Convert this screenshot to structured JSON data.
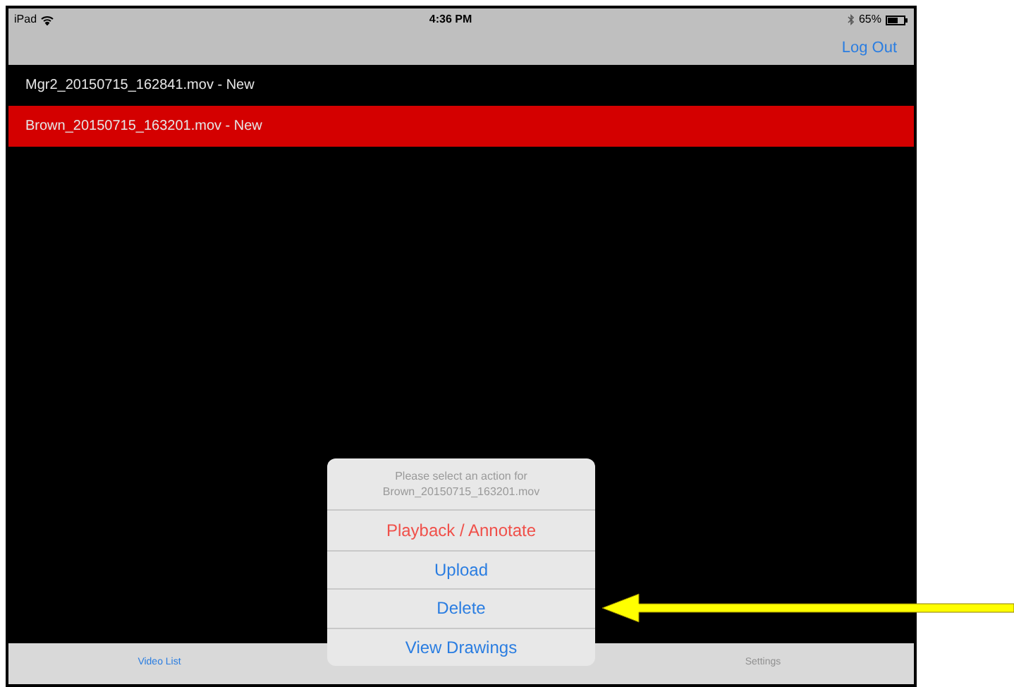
{
  "status_bar": {
    "device": "iPad",
    "time": "4:36 PM",
    "battery": "65%"
  },
  "nav_bar": {
    "button": "Log Out"
  },
  "videos": [
    {
      "name": "Mgr2_20150715_162841.mov - New",
      "selected": false
    },
    {
      "name": "Brown_20150715_163201.mov - New",
      "selected": true
    }
  ],
  "action_sheet": {
    "message": "Please select an action for Brown_20150715_163201.mov",
    "actions": [
      {
        "label": "Playback / Annotate",
        "kind": "destructive"
      },
      {
        "label": "Upload",
        "kind": "default"
      },
      {
        "label": "Delete",
        "kind": "default"
      },
      {
        "label": "View Drawings",
        "kind": "default"
      }
    ]
  },
  "tabs": [
    {
      "label": "Video List",
      "selected": true
    },
    {
      "label": "Settings",
      "selected": false
    }
  ]
}
